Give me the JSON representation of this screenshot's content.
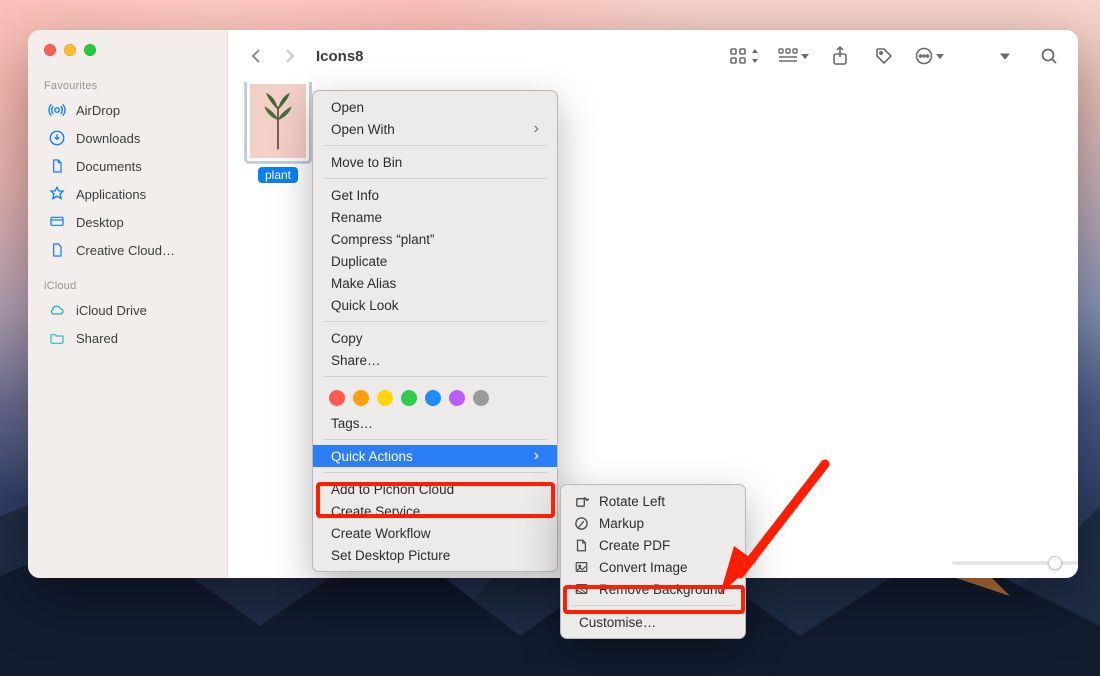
{
  "window": {
    "title": "Icons8"
  },
  "traffic": {
    "close": "close",
    "min": "minimize",
    "max": "maximize"
  },
  "sidebar": {
    "groups": [
      {
        "label": "Favourites",
        "items": [
          {
            "icon": "airdrop",
            "label": "AirDrop"
          },
          {
            "icon": "downloads",
            "label": "Downloads"
          },
          {
            "icon": "documents",
            "label": "Documents"
          },
          {
            "icon": "apps",
            "label": "Applications"
          },
          {
            "icon": "desktop",
            "label": "Desktop"
          },
          {
            "icon": "file",
            "label": "Creative Cloud…"
          }
        ]
      },
      {
        "label": "iCloud",
        "items": [
          {
            "icon": "icloud",
            "label": "iCloud Drive"
          },
          {
            "icon": "shared",
            "label": "Shared"
          }
        ]
      }
    ]
  },
  "file": {
    "name": "plant"
  },
  "context_menu": {
    "open": "Open",
    "open_with": "Open With",
    "move_to_bin": "Move to Bin",
    "get_info": "Get Info",
    "rename": "Rename",
    "compress": "Compress “plant”",
    "duplicate": "Duplicate",
    "make_alias": "Make Alias",
    "quick_look": "Quick Look",
    "copy": "Copy",
    "share": "Share…",
    "tags": "Tags…",
    "quick_actions": "Quick Actions",
    "add_pichon": "Add to Pichon Cloud",
    "create_service": "Create Service",
    "create_workflow": "Create Workflow",
    "set_desktop": "Set Desktop Picture"
  },
  "quick_actions_submenu": {
    "rotate_left": "Rotate Left",
    "markup": "Markup",
    "create_pdf": "Create PDF",
    "convert_image": "Convert Image",
    "remove_bg": "Remove Background",
    "customise": "Customise…"
  },
  "tag_colors": [
    "#ff5b50",
    "#ff9e0b",
    "#ffd40b",
    "#2ecb4f",
    "#1e8bff",
    "#bb5cff",
    "#9a9a9a"
  ],
  "annotation": {
    "highlight_targets": [
      "Quick Actions",
      "Remove Background"
    ],
    "arrow": "points to Remove Background"
  }
}
